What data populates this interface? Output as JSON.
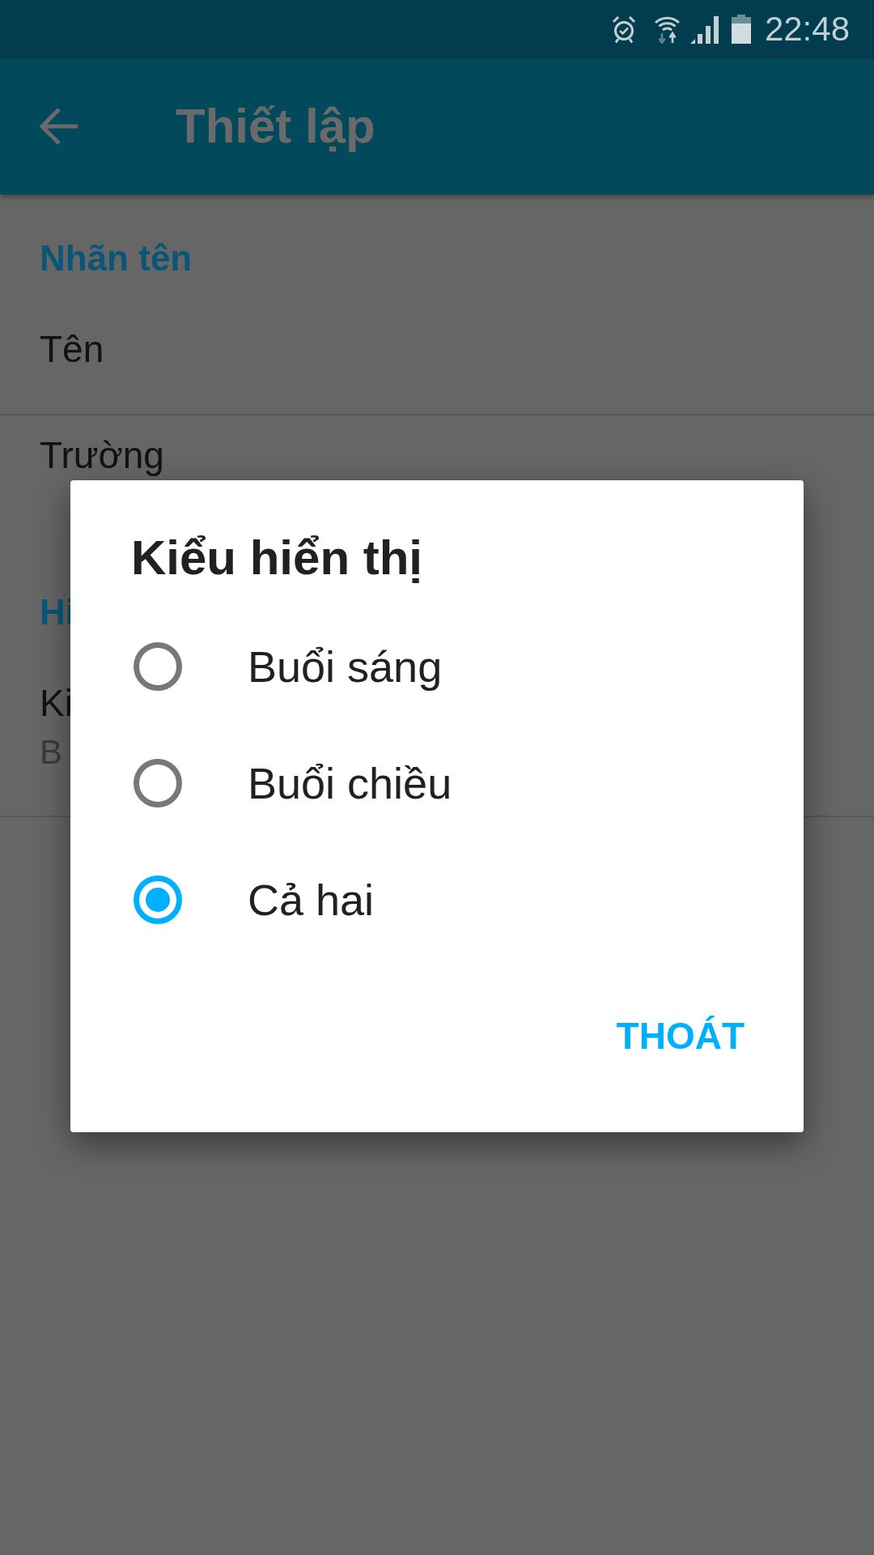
{
  "status_bar": {
    "time": "22:48"
  },
  "app_bar": {
    "title": "Thiết lập"
  },
  "settings": [
    {
      "kind": "header",
      "text": "Nhãn tên"
    },
    {
      "kind": "item",
      "title": "Tên"
    },
    {
      "kind": "divider"
    },
    {
      "kind": "item",
      "title": "Trường"
    },
    {
      "kind": "header",
      "text": "Hi"
    },
    {
      "kind": "item",
      "title": "Ki",
      "summary": "B"
    },
    {
      "kind": "divider"
    }
  ],
  "dialog": {
    "title": "Kiểu hiển thị",
    "options": [
      {
        "label": "Buổi sáng",
        "selected": false
      },
      {
        "label": "Buổi chiều",
        "selected": false
      },
      {
        "label": "Cả hai",
        "selected": true
      }
    ],
    "buttons": [
      "THOÁT"
    ]
  }
}
